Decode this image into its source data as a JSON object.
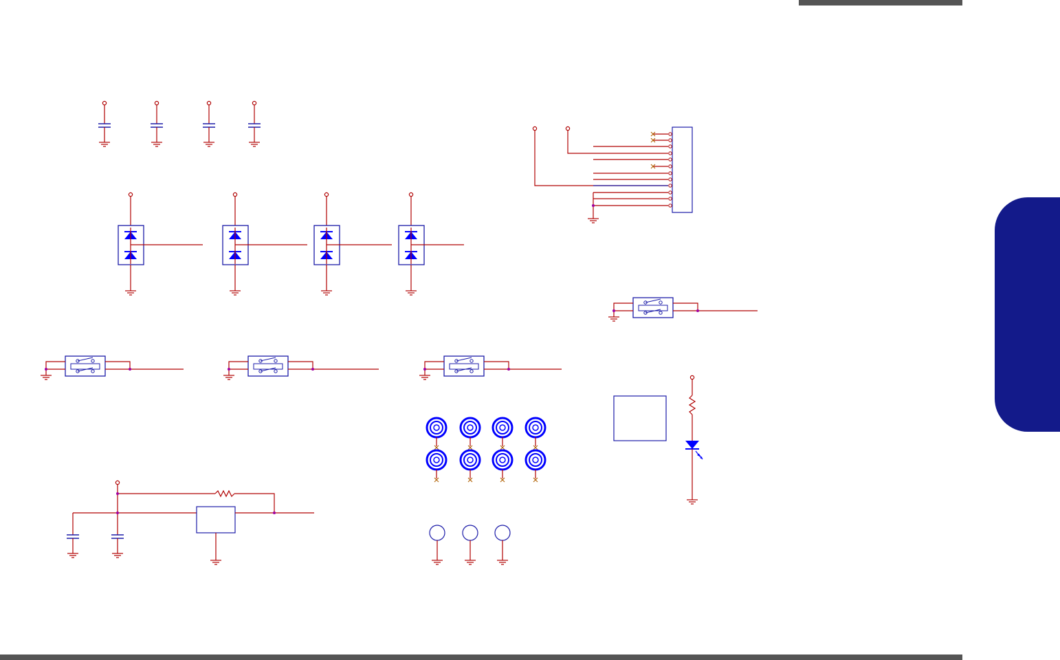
{
  "page": {
    "colors": {
      "wire": "#b00000",
      "wire_blue": "#1a1aa8",
      "symbol": "#1a1aa8",
      "component_fill": "#0000ff",
      "junction": "#a000a0",
      "no_connect": "#b06000",
      "tab": "#131a8a",
      "bar": "#555555"
    }
  },
  "schematic": {
    "decoupling_caps": 4,
    "esd_diode_arrays": 4,
    "tact_switches": 4,
    "connector_pins": 12,
    "connector_no_connect_pins": 3,
    "screw_holes": 8,
    "test_points": 3,
    "regulator_caps": 2,
    "status_led": 1,
    "icons": [
      "capacitor-icon",
      "diode-icon",
      "switch-icon",
      "ground-icon",
      "screw-hole-icon",
      "led-icon",
      "resistor-icon",
      "no-connect-icon"
    ]
  }
}
